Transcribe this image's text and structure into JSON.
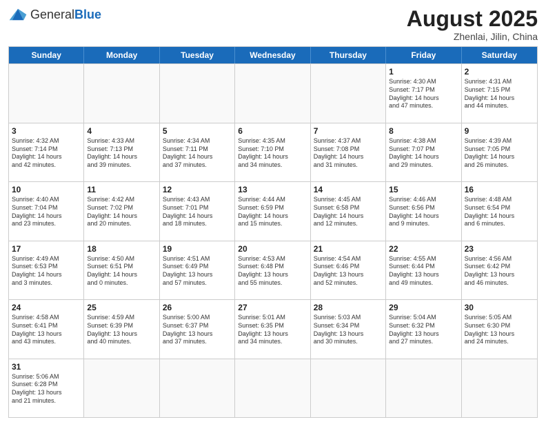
{
  "header": {
    "logo_general": "General",
    "logo_blue": "Blue",
    "month_title": "August 2025",
    "subtitle": "Zhenlai, Jilin, China"
  },
  "days_of_week": [
    "Sunday",
    "Monday",
    "Tuesday",
    "Wednesday",
    "Thursday",
    "Friday",
    "Saturday"
  ],
  "weeks": [
    [
      {
        "day": "",
        "info": ""
      },
      {
        "day": "",
        "info": ""
      },
      {
        "day": "",
        "info": ""
      },
      {
        "day": "",
        "info": ""
      },
      {
        "day": "",
        "info": ""
      },
      {
        "day": "1",
        "info": "Sunrise: 4:30 AM\nSunset: 7:17 PM\nDaylight: 14 hours\nand 47 minutes."
      },
      {
        "day": "2",
        "info": "Sunrise: 4:31 AM\nSunset: 7:15 PM\nDaylight: 14 hours\nand 44 minutes."
      }
    ],
    [
      {
        "day": "3",
        "info": "Sunrise: 4:32 AM\nSunset: 7:14 PM\nDaylight: 14 hours\nand 42 minutes."
      },
      {
        "day": "4",
        "info": "Sunrise: 4:33 AM\nSunset: 7:13 PM\nDaylight: 14 hours\nand 39 minutes."
      },
      {
        "day": "5",
        "info": "Sunrise: 4:34 AM\nSunset: 7:11 PM\nDaylight: 14 hours\nand 37 minutes."
      },
      {
        "day": "6",
        "info": "Sunrise: 4:35 AM\nSunset: 7:10 PM\nDaylight: 14 hours\nand 34 minutes."
      },
      {
        "day": "7",
        "info": "Sunrise: 4:37 AM\nSunset: 7:08 PM\nDaylight: 14 hours\nand 31 minutes."
      },
      {
        "day": "8",
        "info": "Sunrise: 4:38 AM\nSunset: 7:07 PM\nDaylight: 14 hours\nand 29 minutes."
      },
      {
        "day": "9",
        "info": "Sunrise: 4:39 AM\nSunset: 7:05 PM\nDaylight: 14 hours\nand 26 minutes."
      }
    ],
    [
      {
        "day": "10",
        "info": "Sunrise: 4:40 AM\nSunset: 7:04 PM\nDaylight: 14 hours\nand 23 minutes."
      },
      {
        "day": "11",
        "info": "Sunrise: 4:42 AM\nSunset: 7:02 PM\nDaylight: 14 hours\nand 20 minutes."
      },
      {
        "day": "12",
        "info": "Sunrise: 4:43 AM\nSunset: 7:01 PM\nDaylight: 14 hours\nand 18 minutes."
      },
      {
        "day": "13",
        "info": "Sunrise: 4:44 AM\nSunset: 6:59 PM\nDaylight: 14 hours\nand 15 minutes."
      },
      {
        "day": "14",
        "info": "Sunrise: 4:45 AM\nSunset: 6:58 PM\nDaylight: 14 hours\nand 12 minutes."
      },
      {
        "day": "15",
        "info": "Sunrise: 4:46 AM\nSunset: 6:56 PM\nDaylight: 14 hours\nand 9 minutes."
      },
      {
        "day": "16",
        "info": "Sunrise: 4:48 AM\nSunset: 6:54 PM\nDaylight: 14 hours\nand 6 minutes."
      }
    ],
    [
      {
        "day": "17",
        "info": "Sunrise: 4:49 AM\nSunset: 6:53 PM\nDaylight: 14 hours\nand 3 minutes."
      },
      {
        "day": "18",
        "info": "Sunrise: 4:50 AM\nSunset: 6:51 PM\nDaylight: 14 hours\nand 0 minutes."
      },
      {
        "day": "19",
        "info": "Sunrise: 4:51 AM\nSunset: 6:49 PM\nDaylight: 13 hours\nand 57 minutes."
      },
      {
        "day": "20",
        "info": "Sunrise: 4:53 AM\nSunset: 6:48 PM\nDaylight: 13 hours\nand 55 minutes."
      },
      {
        "day": "21",
        "info": "Sunrise: 4:54 AM\nSunset: 6:46 PM\nDaylight: 13 hours\nand 52 minutes."
      },
      {
        "day": "22",
        "info": "Sunrise: 4:55 AM\nSunset: 6:44 PM\nDaylight: 13 hours\nand 49 minutes."
      },
      {
        "day": "23",
        "info": "Sunrise: 4:56 AM\nSunset: 6:42 PM\nDaylight: 13 hours\nand 46 minutes."
      }
    ],
    [
      {
        "day": "24",
        "info": "Sunrise: 4:58 AM\nSunset: 6:41 PM\nDaylight: 13 hours\nand 43 minutes."
      },
      {
        "day": "25",
        "info": "Sunrise: 4:59 AM\nSunset: 6:39 PM\nDaylight: 13 hours\nand 40 minutes."
      },
      {
        "day": "26",
        "info": "Sunrise: 5:00 AM\nSunset: 6:37 PM\nDaylight: 13 hours\nand 37 minutes."
      },
      {
        "day": "27",
        "info": "Sunrise: 5:01 AM\nSunset: 6:35 PM\nDaylight: 13 hours\nand 34 minutes."
      },
      {
        "day": "28",
        "info": "Sunrise: 5:03 AM\nSunset: 6:34 PM\nDaylight: 13 hours\nand 30 minutes."
      },
      {
        "day": "29",
        "info": "Sunrise: 5:04 AM\nSunset: 6:32 PM\nDaylight: 13 hours\nand 27 minutes."
      },
      {
        "day": "30",
        "info": "Sunrise: 5:05 AM\nSunset: 6:30 PM\nDaylight: 13 hours\nand 24 minutes."
      }
    ],
    [
      {
        "day": "31",
        "info": "Sunrise: 5:06 AM\nSunset: 6:28 PM\nDaylight: 13 hours\nand 21 minutes."
      },
      {
        "day": "",
        "info": ""
      },
      {
        "day": "",
        "info": ""
      },
      {
        "day": "",
        "info": ""
      },
      {
        "day": "",
        "info": ""
      },
      {
        "day": "",
        "info": ""
      },
      {
        "day": "",
        "info": ""
      }
    ]
  ]
}
